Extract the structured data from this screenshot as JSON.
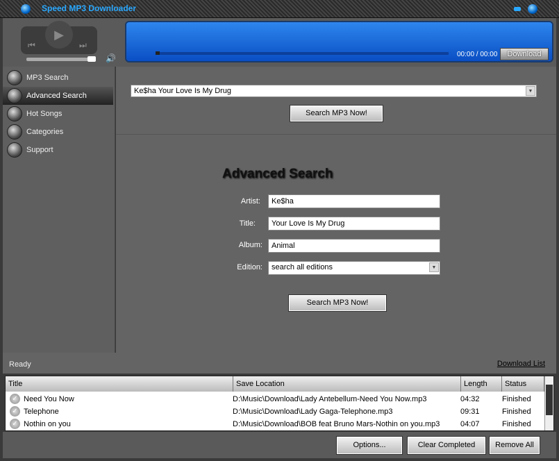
{
  "app": {
    "title": "Speed MP3 Downloader"
  },
  "player": {
    "time": "00:00 / 00:00",
    "download_label": "Download",
    "volume_percent": 90,
    "progress_percent": 0
  },
  "sidebar": {
    "items": [
      {
        "label": "MP3 Search"
      },
      {
        "label": "Advanced Search"
      },
      {
        "label": "Hot Songs"
      },
      {
        "label": "Categories"
      },
      {
        "label": "Support"
      }
    ]
  },
  "search": {
    "query": "Ke$ha Your Love Is My Drug",
    "button": "Search MP3 Now!"
  },
  "advanced": {
    "heading": "Advanced Search",
    "artist_label": "Artist:",
    "artist": "Ke$ha",
    "title_label": "Title:",
    "title": "Your Love Is My Drug",
    "album_label": "Album:",
    "album": "Animal",
    "edition_label": "Edition:",
    "edition": "search all editions",
    "button": "Search MP3 Now!"
  },
  "status": {
    "text": "Ready",
    "download_list": "Download List"
  },
  "table": {
    "headers": [
      "Title",
      "Save Location",
      "Length",
      "Status"
    ],
    "rows": [
      {
        "title": "Need You Now",
        "location": "D:\\Music\\Download\\Lady Antebellum-Need You Now.mp3",
        "length": "04:32",
        "status": "Finished"
      },
      {
        "title": "Telephone",
        "location": "D:\\Music\\Download\\Lady Gaga-Telephone.mp3",
        "length": "09:31",
        "status": "Finished"
      },
      {
        "title": "Nothin on you",
        "location": "D:\\Music\\Download\\BOB feat Bruno Mars-Nothin on you.mp3",
        "length": "04:07",
        "status": "Finished"
      }
    ]
  },
  "buttons": {
    "options": "Options...",
    "clear": "Clear Completed",
    "remove": "Remove All"
  }
}
